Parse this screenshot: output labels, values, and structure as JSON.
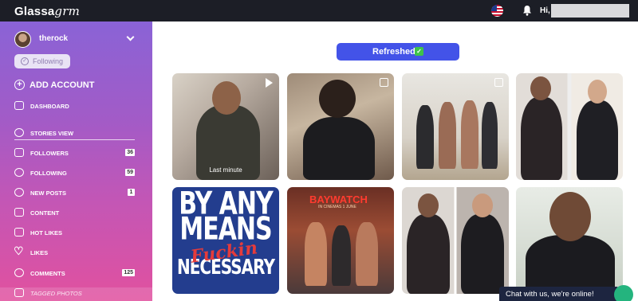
{
  "header": {
    "logo_main": "Glassa",
    "logo_italic": "grm",
    "greeting": "Hi, I",
    "flag_icon": "us-flag-icon",
    "bell_icon": "bell-icon"
  },
  "sidebar": {
    "account_name": "therock",
    "follow_label": "Following",
    "add_account": "ADD ACCOUNT",
    "items": [
      {
        "label": "DASHBOARD",
        "icon": "dashboard-icon",
        "badge": ""
      },
      {
        "label": "STORIES VIEW",
        "icon": "clock-icon",
        "badge": ""
      },
      {
        "label": "FOLLOWERS",
        "icon": "followers-icon",
        "badge": "36"
      },
      {
        "label": "FOLLOWING",
        "icon": "following-icon",
        "badge": "59"
      },
      {
        "label": "NEW POSTS",
        "icon": "bell-icon",
        "badge": "1"
      },
      {
        "label": "CONTENT",
        "icon": "image-icon",
        "badge": ""
      },
      {
        "label": "HOT LIKES",
        "icon": "thumbs-up-icon",
        "badge": ""
      },
      {
        "label": "LIKES",
        "icon": "heart-icon",
        "badge": ""
      },
      {
        "label": "COMMENTS",
        "icon": "comment-icon",
        "badge": "125"
      },
      {
        "label": "TAGGED PHOTOS",
        "icon": "tag-icon",
        "badge": ""
      }
    ]
  },
  "main": {
    "refresh_label": "Refreshed",
    "tiles": [
      {
        "caption": "Last minute"
      },
      {
        "caption": ""
      },
      {
        "caption": ""
      },
      {
        "caption": ""
      },
      {
        "caption": "",
        "text_l1": "BY ANY",
        "text_l2": "MEANS",
        "text_script": "Fuckin",
        "text_l3": "NECESSARY"
      },
      {
        "caption": "",
        "title": "BAYWATCH",
        "subtitle": "IN CINEMAS 1 JUNE"
      },
      {
        "caption": ""
      },
      {
        "caption": ""
      }
    ]
  },
  "chat": {
    "label": "Chat with us, we're online!"
  }
}
